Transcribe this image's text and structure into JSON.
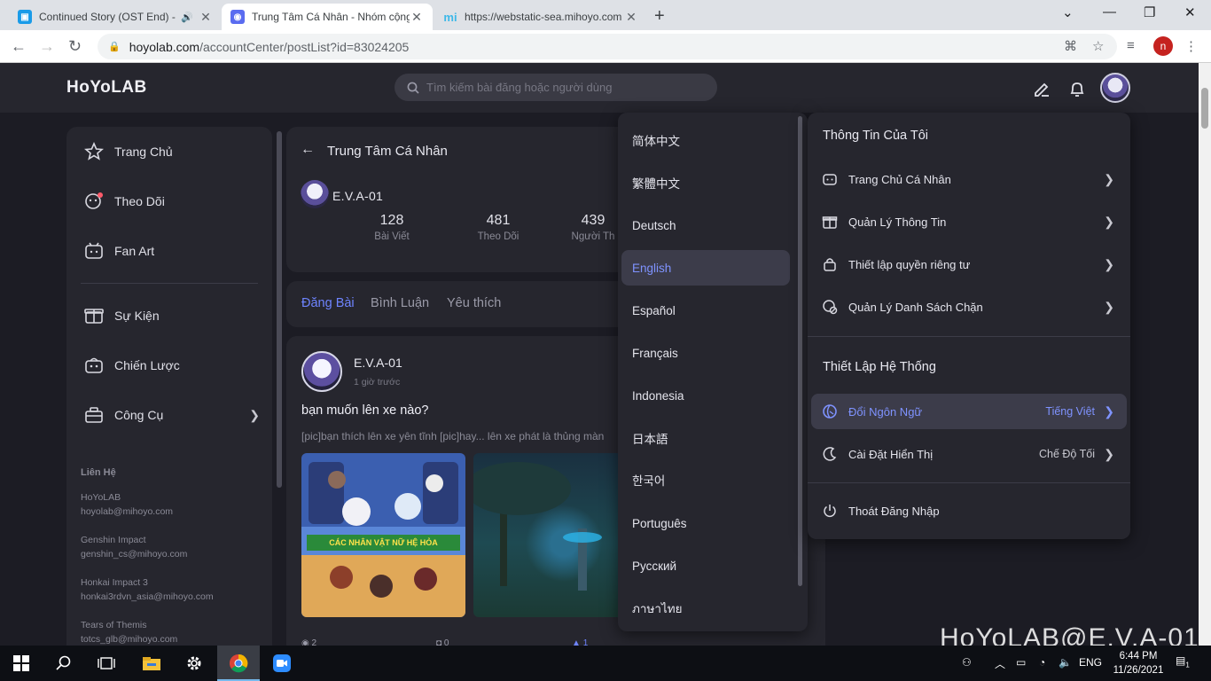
{
  "browser": {
    "tabs": [
      {
        "title": "Continued Story (OST End) -",
        "favicon": "screencast-icon",
        "audio": true
      },
      {
        "title": "Trung Tâm Cá Nhân - Nhóm cộng",
        "favicon": "hoyolab-icon"
      },
      {
        "title": "https://webstatic-sea.mihoyo.com",
        "favicon": "mihoyo-icon"
      }
    ],
    "url_host": "hoyolab.com",
    "url_path": "/accountCenter/postList?id=83024205",
    "profile_initial": "n"
  },
  "header": {
    "logo": "HoYoLAB",
    "search_placeholder": "Tìm kiếm bài đăng hoặc người dùng"
  },
  "sidebar": {
    "items": [
      {
        "label": "Trang Chủ",
        "icon": "home-icon"
      },
      {
        "label": "Theo Dõi",
        "icon": "follow-icon"
      },
      {
        "label": "Fan Art",
        "icon": "fanart-icon"
      },
      {
        "label": "Sự Kiện",
        "icon": "event-icon"
      },
      {
        "label": "Chiến Lược",
        "icon": "strategy-icon"
      },
      {
        "label": "Công Cụ",
        "icon": "tools-icon"
      }
    ],
    "contact_title": "Liên Hệ",
    "contacts": [
      {
        "name": "HoYoLAB",
        "email": "hoyolab@mihoyo.com"
      },
      {
        "name": "Genshin Impact",
        "email": "genshin_cs@mihoyo.com"
      },
      {
        "name": "Honkai Impact 3",
        "email": "honkai3rdvn_asia@mihoyo.com"
      },
      {
        "name": "Tears of Themis",
        "email": "totcs_glb@mihoyo.com"
      }
    ]
  },
  "profile": {
    "page_title": "Trung Tâm Cá Nhân",
    "username": "E.V.A-01",
    "stats": [
      {
        "value": "128",
        "label": "Bài Viết"
      },
      {
        "value": "481",
        "label": "Theo Dõi"
      },
      {
        "value": "439",
        "label": "Người Th"
      }
    ],
    "tabs": [
      "Đăng Bài",
      "Bình Luận",
      "Yêu thích"
    ]
  },
  "post": {
    "author": "E.V.A-01",
    "time": "1 giờ trước",
    "title": "bạn muốn lên xe nào?",
    "excerpt": "[pic]bạn thích lên xe yên tĩnh [pic]hay... lên xe phát là thủng màn",
    "image_caption": "CÁC NHÂN VẬT NỮ HỆ HỎA",
    "views": "2",
    "comments": "0",
    "likes": "1"
  },
  "language_menu": {
    "items": [
      "简体中文",
      "繁體中文",
      "Deutsch",
      "English",
      "Español",
      "Français",
      "Indonesia",
      "日本語",
      "한국어",
      "Português",
      "Русский",
      "ภาษาไทย"
    ],
    "selected": "English"
  },
  "account_menu": {
    "section1_title": "Thông Tin Của Tôi",
    "section1": [
      {
        "label": "Trang Chủ Cá Nhân",
        "icon": "profile-icon"
      },
      {
        "label": "Quản Lý Thông Tin",
        "icon": "gift-icon"
      },
      {
        "label": "Thiết lập quyền riêng tư",
        "icon": "privacy-icon"
      },
      {
        "label": "Quản Lý Danh Sách Chặn",
        "icon": "block-icon"
      }
    ],
    "section2_title": "Thiết Lập Hệ Thống",
    "language_row": {
      "label": "Đổi Ngôn Ngữ",
      "value": "Tiếng Việt",
      "icon": "globe-icon"
    },
    "display_row": {
      "label": "Cài Đặt Hiển Thị",
      "value": "Chế Độ Tối",
      "icon": "moon-icon"
    },
    "logout": {
      "label": "Thoát Đăng Nhập",
      "icon": "power-icon"
    }
  },
  "watermark": "HoYoLAB@E.V.A-01",
  "taskbar": {
    "lang": "ENG",
    "time": "6:44 PM",
    "date": "11/26/2021",
    "notifications": "1"
  }
}
